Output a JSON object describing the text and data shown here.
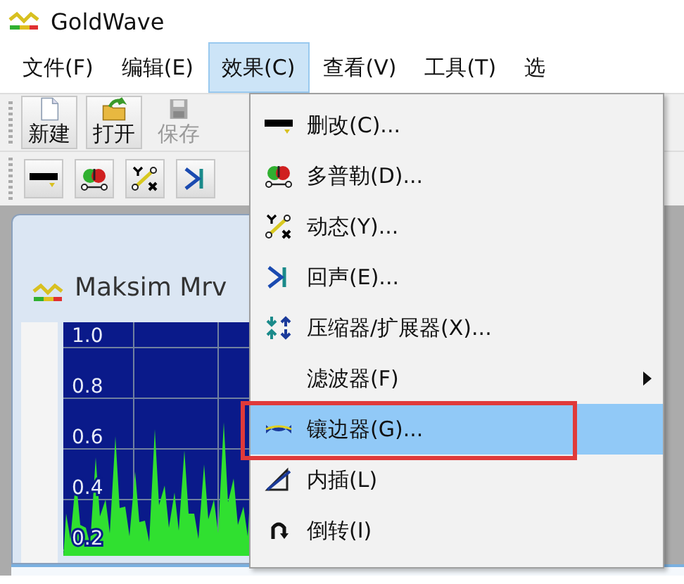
{
  "window": {
    "title": "GoldWave"
  },
  "menu_bar": [
    {
      "label": "文件(F)",
      "selected": false
    },
    {
      "label": "编辑(E)",
      "selected": false
    },
    {
      "label": "效果(C)",
      "selected": true
    },
    {
      "label": "查看(V)",
      "selected": false
    },
    {
      "label": "工具(T)",
      "selected": false
    },
    {
      "label": "选",
      "selected": false
    }
  ],
  "toolbar": [
    {
      "label": "新建",
      "kind": "new",
      "disabled": false
    },
    {
      "label": "打开",
      "kind": "open",
      "disabled": false
    },
    {
      "label": "保存",
      "kind": "save",
      "disabled": true
    }
  ],
  "effects_toolbar": [
    {
      "kind": "trim"
    },
    {
      "kind": "doppler"
    },
    {
      "kind": "dynamics"
    },
    {
      "kind": "echo"
    }
  ],
  "document": {
    "title": "Maksim Mrv",
    "y_axis_labels": [
      "1.0",
      "0.8",
      "0.6",
      "0.4",
      "0.2"
    ]
  },
  "effects_menu": {
    "items": [
      {
        "label": "删改(C)...",
        "kind": "trim",
        "selected": false,
        "highlighted": false,
        "submenu": false
      },
      {
        "label": "多普勒(D)...",
        "kind": "doppler",
        "selected": false,
        "highlighted": false,
        "submenu": false
      },
      {
        "label": "动态(Y)...",
        "kind": "dynamics",
        "selected": false,
        "highlighted": false,
        "submenu": false
      },
      {
        "label": "回声(E)...",
        "kind": "echo",
        "selected": false,
        "highlighted": false,
        "submenu": false
      },
      {
        "label": "压缩器/扩展器(X)...",
        "kind": "compressor",
        "selected": false,
        "highlighted": false,
        "submenu": false
      },
      {
        "label": "滤波器(F)",
        "kind": "none",
        "selected": false,
        "highlighted": false,
        "submenu": true
      },
      {
        "label": "镶边器(G)...",
        "kind": "flanger",
        "selected": true,
        "highlighted": true,
        "submenu": false
      },
      {
        "label": "内插(L)",
        "kind": "interpolate",
        "selected": false,
        "highlighted": false,
        "submenu": false
      },
      {
        "label": "倒转(I)",
        "kind": "invert",
        "selected": false,
        "highlighted": false,
        "submenu": false
      }
    ]
  }
}
